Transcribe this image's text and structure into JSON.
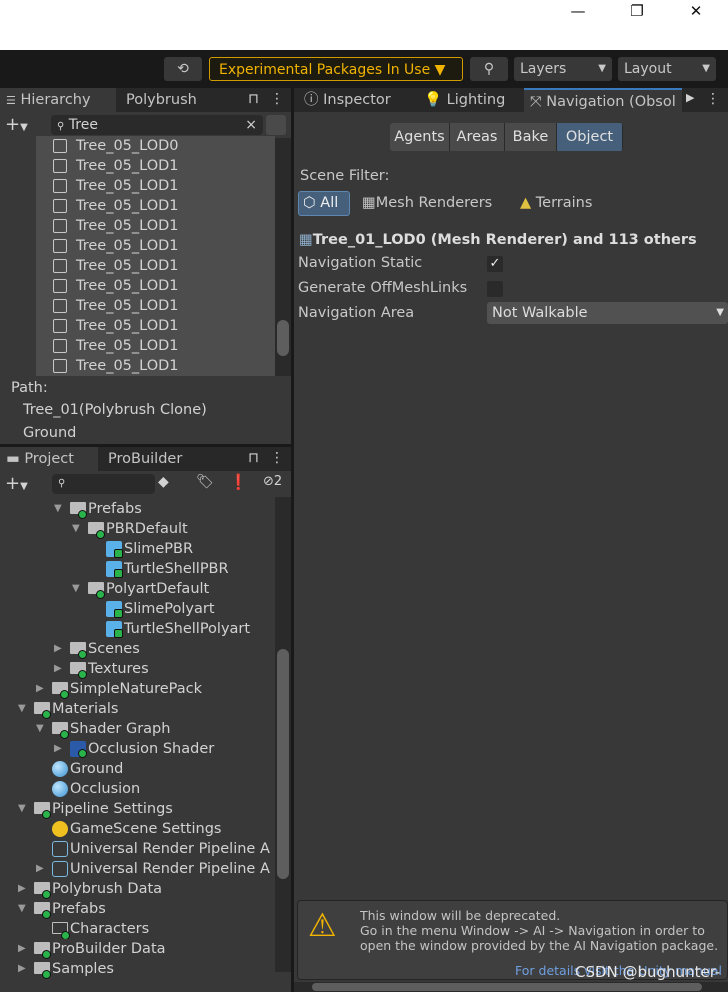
{
  "window": {
    "minimize": "—",
    "maximize": "❐",
    "close": "✕"
  },
  "toolbar": {
    "experimental": "Experimental Packages In Use",
    "layers": "Layers",
    "layout": "Layout"
  },
  "hierarchy": {
    "tab": "Hierarchy",
    "tab2": "Polybrush",
    "search": "Tree",
    "items": [
      "Tree_05_LOD0",
      "Tree_05_LOD1",
      "Tree_05_LOD1",
      "Tree_05_LOD1",
      "Tree_05_LOD1",
      "Tree_05_LOD1",
      "Tree_05_LOD1",
      "Tree_05_LOD1",
      "Tree_05_LOD1",
      "Tree_05_LOD1",
      "Tree_05_LOD1",
      "Tree_05_LOD1"
    ],
    "path_label": "Path:",
    "path": [
      "Tree_01(Polybrush Clone)",
      "Ground"
    ]
  },
  "project": {
    "tab": "Project",
    "tab2": "ProBuilder",
    "hidden_count": "2",
    "items": [
      {
        "label": "Prefabs",
        "level": 3,
        "arrow": "open",
        "icon": "folder"
      },
      {
        "label": "PBRDefault",
        "level": 4,
        "arrow": "open",
        "icon": "folder"
      },
      {
        "label": "SlimePBR",
        "level": 5,
        "arrow": "",
        "icon": "prefab"
      },
      {
        "label": "TurtleShellPBR",
        "level": 5,
        "arrow": "",
        "icon": "prefab"
      },
      {
        "label": "PolyartDefault",
        "level": 4,
        "arrow": "open",
        "icon": "folder"
      },
      {
        "label": "SlimePolyart",
        "level": 5,
        "arrow": "",
        "icon": "prefab"
      },
      {
        "label": "TurtleShellPolyart",
        "level": 5,
        "arrow": "",
        "icon": "prefab"
      },
      {
        "label": "Scenes",
        "level": 3,
        "arrow": "closed",
        "icon": "folder"
      },
      {
        "label": "Textures",
        "level": 3,
        "arrow": "closed",
        "icon": "folder"
      },
      {
        "label": "SimpleNaturePack",
        "level": 2,
        "arrow": "closed",
        "icon": "folder"
      },
      {
        "label": "Materials",
        "level": 1,
        "arrow": "open",
        "icon": "folder"
      },
      {
        "label": "Shader Graph",
        "level": 2,
        "arrow": "open",
        "icon": "folder"
      },
      {
        "label": "Occlusion Shader",
        "level": 3,
        "arrow": "closed",
        "icon": "shader"
      },
      {
        "label": "Ground",
        "level": 2,
        "arrow": "",
        "icon": "material"
      },
      {
        "label": "Occlusion",
        "level": 2,
        "arrow": "",
        "icon": "material"
      },
      {
        "label": "Pipeline Settings",
        "level": 1,
        "arrow": "open",
        "icon": "folder"
      },
      {
        "label": "GameScene Settings",
        "level": 2,
        "arrow": "",
        "icon": "lightbulb"
      },
      {
        "label": "Universal Render Pipeline A",
        "level": 2,
        "arrow": "",
        "icon": "asset"
      },
      {
        "label": "Universal Render Pipeline A",
        "level": 2,
        "arrow": "closed",
        "icon": "asset"
      },
      {
        "label": "Polybrush Data",
        "level": 1,
        "arrow": "closed",
        "icon": "folder"
      },
      {
        "label": "Prefabs",
        "level": 1,
        "arrow": "open",
        "icon": "folder"
      },
      {
        "label": "Characters",
        "level": 2,
        "arrow": "",
        "icon": "folder-empty"
      },
      {
        "label": "ProBuilder Data",
        "level": 1,
        "arrow": "closed",
        "icon": "folder"
      },
      {
        "label": "Samples",
        "level": 1,
        "arrow": "closed",
        "icon": "folder"
      }
    ]
  },
  "inspector": {
    "tabs": [
      "Inspector",
      "Lighting",
      "Navigation (Obsol"
    ],
    "segments": [
      "Agents",
      "Areas",
      "Bake",
      "Object"
    ],
    "active_segment": "Object",
    "scene_filter": "Scene Filter:",
    "filters": [
      "All",
      "Mesh Renderers",
      "Terrains"
    ],
    "selection": "Tree_01_LOD0 (Mesh Renderer) and 113 others",
    "nav_static": "Navigation Static",
    "nav_static_checked": true,
    "offmesh": "Generate OffMeshLinks",
    "offmesh_checked": false,
    "area_label": "Navigation Area",
    "area_value": "Not Walkable",
    "warning": [
      "This window will be deprecated.",
      "Go in the menu Window -> AI -> Navigation in order to",
      "open the window provided by the AI Navigation package."
    ],
    "link": "For details visit the Unity manual"
  },
  "watermark": "CSDN @bughunter-",
  "colors": {
    "accent": "#4b6a8a",
    "warning": "#f0b300",
    "link": "#6f9fe0"
  }
}
